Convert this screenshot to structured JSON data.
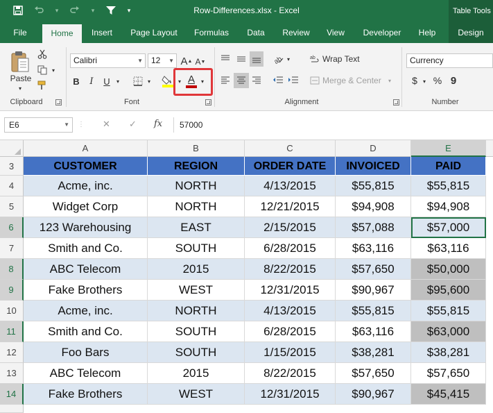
{
  "window": {
    "title": "Row-Differences.xlsx  -  Excel",
    "context_tab": "Table Tools"
  },
  "qat": {
    "save_icon": "save-icon",
    "undo_icon": "undo-icon",
    "redo_icon": "redo-icon",
    "filter_icon": "filter-icon"
  },
  "tabs": [
    "File",
    "Home",
    "Insert",
    "Page Layout",
    "Formulas",
    "Data",
    "Review",
    "View",
    "Developer",
    "Help",
    "Design"
  ],
  "ribbon": {
    "clipboard": {
      "paste_label": "Paste",
      "group_label": "Clipboard"
    },
    "font": {
      "font_name": "Calibri",
      "font_size": "12",
      "bold": "B",
      "italic": "I",
      "underline": "U",
      "grow": "A",
      "shrink": "A",
      "font_color_glyph": "A",
      "font_color": "#c00000",
      "highlight_color": "#ffff00",
      "group_label": "Font"
    },
    "alignment": {
      "wrap_text": "Wrap Text",
      "merge_center": "Merge & Center",
      "group_label": "Alignment"
    },
    "number": {
      "format": "Currency",
      "dollar": "$",
      "percent": "%",
      "comma": "9",
      "group_label": "Number"
    }
  },
  "formula_bar": {
    "name_box": "E6",
    "cancel": "✕",
    "enter": "✓",
    "fx": "fx",
    "value": "57000"
  },
  "columns": [
    "A",
    "B",
    "C",
    "D",
    "E"
  ],
  "selected_column": "E",
  "header_row_number": "3",
  "headers": [
    "CUSTOMER",
    "REGION",
    "ORDER DATE",
    "INVOICED",
    "PAID"
  ],
  "rows": [
    {
      "num": "4",
      "cells": [
        "Acme, inc.",
        "NORTH",
        "4/13/2015",
        "$55,815",
        "$55,815"
      ],
      "band": true,
      "grey": false,
      "rowsel": false
    },
    {
      "num": "5",
      "cells": [
        "Widget Corp",
        "NORTH",
        "12/21/2015",
        "$94,908",
        "$94,908"
      ],
      "band": false,
      "grey": false,
      "rowsel": false
    },
    {
      "num": "6",
      "cells": [
        "123 Warehousing",
        "EAST",
        "2/15/2015",
        "$57,088",
        "$57,000"
      ],
      "band": true,
      "grey": false,
      "rowsel": true
    },
    {
      "num": "7",
      "cells": [
        "Smith and Co.",
        "SOUTH",
        "6/28/2015",
        "$63,116",
        "$63,116"
      ],
      "band": false,
      "grey": false,
      "rowsel": false
    },
    {
      "num": "8",
      "cells": [
        "ABC Telecom",
        "2015",
        "8/22/2015",
        "$57,650",
        "$50,000"
      ],
      "band": true,
      "grey": true,
      "rowsel": true
    },
    {
      "num": "9",
      "cells": [
        "Fake Brothers",
        "WEST",
        "12/31/2015",
        "$90,967",
        "$95,600"
      ],
      "band": false,
      "grey": true,
      "rowsel": true
    },
    {
      "num": "10",
      "cells": [
        "Acme, inc.",
        "NORTH",
        "4/13/2015",
        "$55,815",
        "$55,815"
      ],
      "band": true,
      "grey": false,
      "rowsel": false
    },
    {
      "num": "11",
      "cells": [
        "Smith and Co.",
        "SOUTH",
        "6/28/2015",
        "$63,116",
        "$63,000"
      ],
      "band": false,
      "grey": true,
      "rowsel": true
    },
    {
      "num": "12",
      "cells": [
        "Foo Bars",
        "SOUTH",
        "1/15/2015",
        "$38,281",
        "$38,281"
      ],
      "band": true,
      "grey": false,
      "rowsel": false
    },
    {
      "num": "13",
      "cells": [
        "ABC Telecom",
        "2015",
        "8/22/2015",
        "$57,650",
        "$57,650"
      ],
      "band": false,
      "grey": false,
      "rowsel": false
    },
    {
      "num": "14",
      "cells": [
        "Fake Brothers",
        "WEST",
        "12/31/2015",
        "$90,967",
        "$45,415"
      ],
      "band": true,
      "grey": true,
      "rowsel": true
    }
  ],
  "active_cell": {
    "row": "6",
    "col": "E"
  },
  "colors": {
    "excel_green": "#217346",
    "header_blue": "#4472c4",
    "band_blue": "#dce6f1",
    "diff_grey": "#bfbfbf",
    "callout_red": "#e0373a"
  }
}
